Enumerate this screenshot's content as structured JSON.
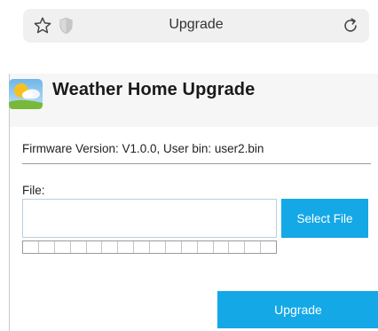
{
  "browser": {
    "tab_title": "Upgrade",
    "icons": [
      "star-icon",
      "shield-icon",
      "reload-icon"
    ]
  },
  "header": {
    "logo": "weather-logo",
    "title": "Weather Home Upgrade"
  },
  "firmware": {
    "info": "Firmware Version: V1.0.0, User bin: user2.bin"
  },
  "upload": {
    "file_label": "File:",
    "file_value": "",
    "select_button": "Select File",
    "progress": 0,
    "segments": 16
  },
  "actions": {
    "upgrade_button": "Upgrade"
  },
  "colors": {
    "accent": "#14a8e6",
    "header_bg": "#f6f6f6",
    "urlbar_bg": "#f0f0f0"
  }
}
